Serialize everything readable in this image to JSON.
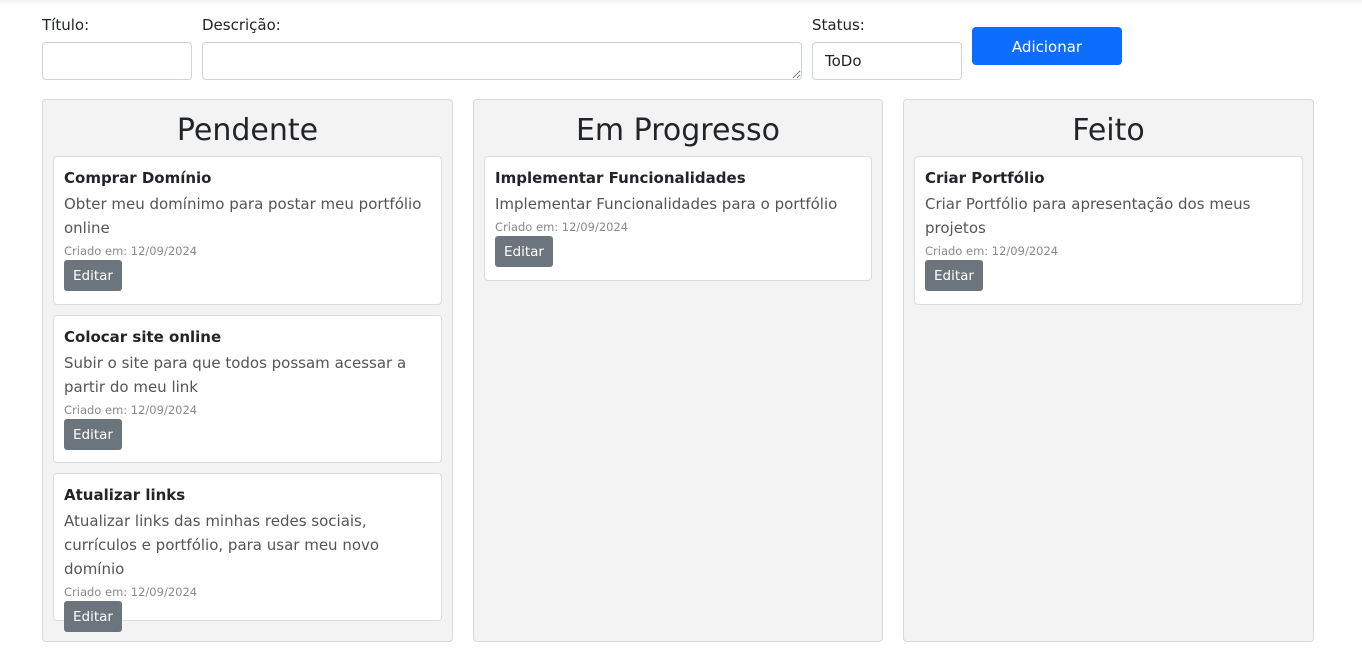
{
  "form": {
    "title_label": "Título:",
    "title_value": "",
    "description_label": "Descrição:",
    "description_value": "",
    "status_label": "Status:",
    "status_value": "ToDo",
    "add_button": "Adicionar"
  },
  "columns": [
    {
      "heading": "Pendente",
      "cards": [
        {
          "title": "Comprar Domínio",
          "description": "Obter meu domínimo para postar meu portfólio online",
          "created": "Criado em: 12/09/2024",
          "edit_label": "Editar"
        },
        {
          "title": "Colocar site online",
          "description": "Subir o site para que todos possam acessar a partir do meu link",
          "created": "Criado em: 12/09/2024",
          "edit_label": "Editar"
        },
        {
          "title": "Atualizar links",
          "description": "Atualizar links das minhas redes sociais, currículos e portfólio, para usar meu novo domínio",
          "created": "Criado em: 12/09/2024",
          "edit_label": "Editar"
        }
      ]
    },
    {
      "heading": "Em Progresso",
      "cards": [
        {
          "title": "Implementar Funcionalidades",
          "description": "Implementar Funcionalidades para o portfólio",
          "created": "Criado em: 12/09/2024",
          "edit_label": "Editar"
        }
      ]
    },
    {
      "heading": "Feito",
      "cards": [
        {
          "title": "Criar Portfólio",
          "description": "Criar Portfólio para apresentação dos meus projetos",
          "created": "Criado em: 12/09/2024",
          "edit_label": "Editar"
        }
      ]
    }
  ],
  "colors": {
    "primary": "#0d6efd",
    "secondary": "#6c757d",
    "column_bg": "#f3f3f3"
  }
}
